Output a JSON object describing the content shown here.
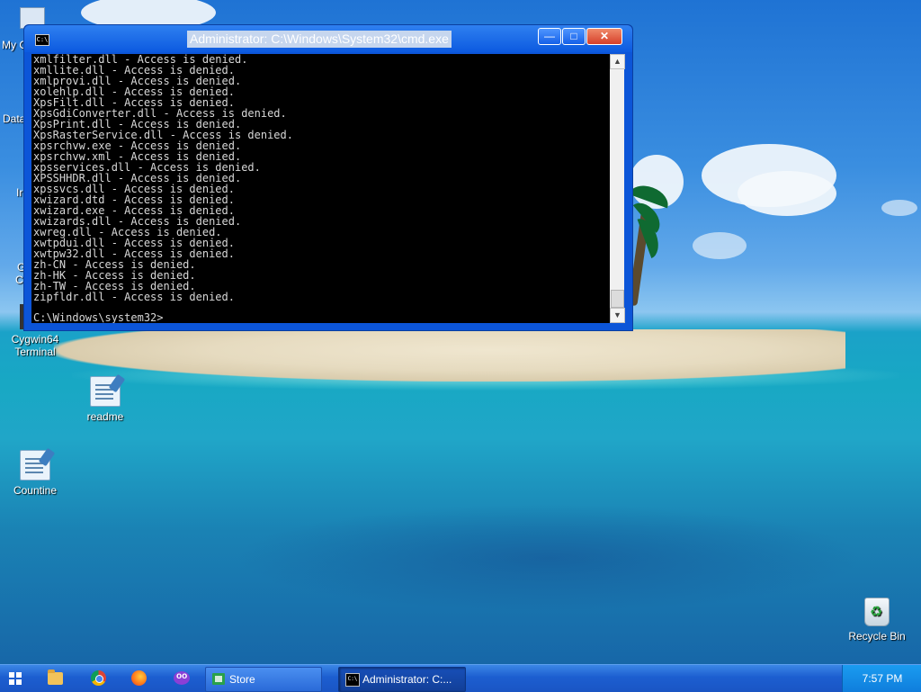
{
  "desktop": {
    "icons": [
      {
        "label": "Cygwin64\nTerminal"
      },
      {
        "label": "readme"
      },
      {
        "label": "Countine"
      },
      {
        "label": "Recycle Bin"
      }
    ],
    "edge_labels": [
      "My C",
      "Data",
      "Ir",
      "G",
      "C"
    ]
  },
  "window": {
    "title": "Administrator:  C:\\Windows\\System32\\cmd.exe",
    "icon_text": "C:\\",
    "minimize": "—",
    "maximize": "□",
    "close": "✕",
    "console_lines": [
      "xmlfilter.dll - Access is denied.",
      "xmllite.dll - Access is denied.",
      "xmlprovi.dll - Access is denied.",
      "xolehlp.dll - Access is denied.",
      "XpsFilt.dll - Access is denied.",
      "XpsGdiConverter.dll - Access is denied.",
      "XpsPrint.dll - Access is denied.",
      "XpsRasterService.dll - Access is denied.",
      "xpsrchvw.exe - Access is denied.",
      "xpsrchvw.xml - Access is denied.",
      "xpsservices.dll - Access is denied.",
      "XPSSHHDR.dll - Access is denied.",
      "xpssvcs.dll - Access is denied.",
      "xwizard.dtd - Access is denied.",
      "xwizard.exe - Access is denied.",
      "xwizards.dll - Access is denied.",
      "xwreg.dll - Access is denied.",
      "xwtpdui.dll - Access is denied.",
      "xwtpw32.dll - Access is denied.",
      "zh-CN - Access is denied.",
      "zh-HK - Access is denied.",
      "zh-TW - Access is denied.",
      "zipfldr.dll - Access is denied."
    ],
    "prompt": "C:\\Windows\\system32>",
    "scroll_up": "▲",
    "scroll_down": "▼"
  },
  "taskbar": {
    "buttons": [
      {
        "label": "Store"
      },
      {
        "label": "Administrator:  C:..."
      }
    ],
    "clock": "7:57 PM"
  }
}
